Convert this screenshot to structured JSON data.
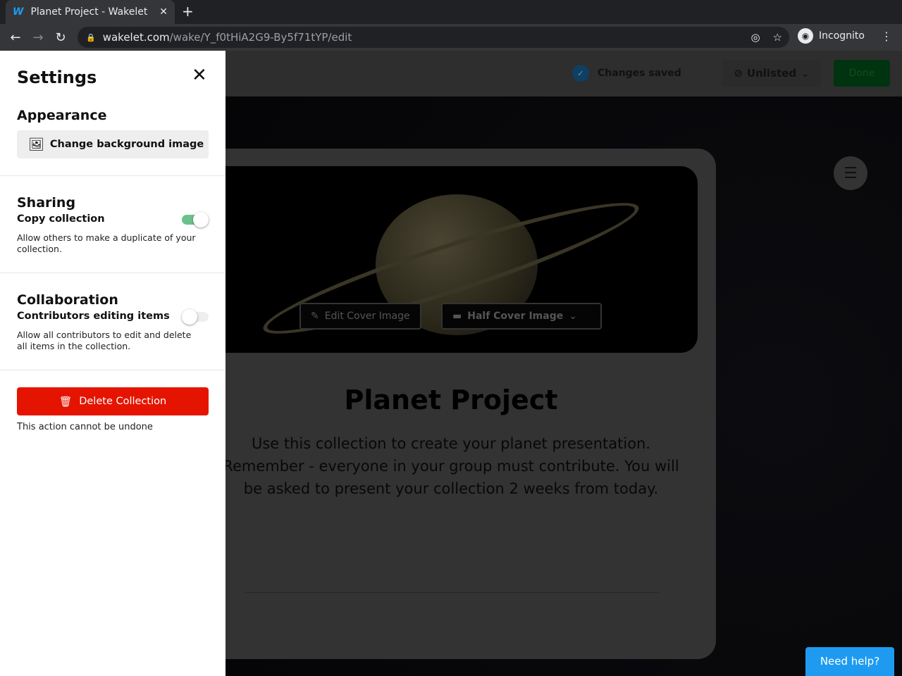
{
  "browser": {
    "tab_title": "Planet Project - Wakelet",
    "favicon": "W",
    "url_host": "wakelet.com",
    "url_path": "/wake/Y_f0tHiA2G9-By5f71tYP/edit",
    "profile": "Incognito"
  },
  "header": {
    "status": "Changes saved",
    "visibility": "Unlisted",
    "done": "Done"
  },
  "cover": {
    "edit": "Edit Cover Image",
    "layout": "Half Cover Image"
  },
  "collection": {
    "title": "Planet Project",
    "description": "Use this collection to create your planet presentation. Remember - everyone in your group must contribute. You will be asked to present your collection 2 weeks from today."
  },
  "help": "Need help?",
  "settings": {
    "title": "Settings",
    "appearance": {
      "heading": "Appearance",
      "button": "Change background image"
    },
    "sharing": {
      "heading": "Sharing",
      "label": "Copy collection",
      "description": "Allow others to make a duplicate of your collection.",
      "enabled": true
    },
    "collaboration": {
      "heading": "Collaboration",
      "label": "Contributors editing items",
      "description": "Allow all contributors to edit and delete all items in the collection.",
      "enabled": false
    },
    "delete": {
      "button": "Delete Collection",
      "warning": "This action cannot be undone"
    },
    "colors": {
      "toggle_on": "#6cc08b",
      "delete": "#e51400"
    }
  }
}
